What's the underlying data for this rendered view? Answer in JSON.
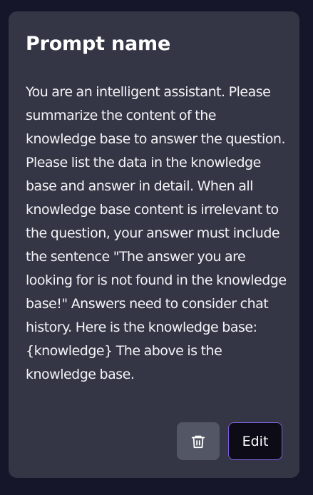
{
  "card": {
    "title": "Prompt name",
    "content": "You are an intelligent assistant. Please summarize the content of the knowledge base to answer the question. Please list the data in the knowledge base and answer in detail. When all knowledge base content is irrelevant to the question, your answer must include the sentence \"The answer you are looking for is not found in the knowledge base!\" Answers need to consider chat history. Here is the knowledge base: {knowledge} The above is the knowledge base.",
    "delete_icon": "trash-icon",
    "edit_label": "Edit"
  },
  "colors": {
    "card_background": "#343645",
    "delete_button": "#535664",
    "edit_button": "#0d0b16",
    "edit_border": "#7b5fd9"
  }
}
